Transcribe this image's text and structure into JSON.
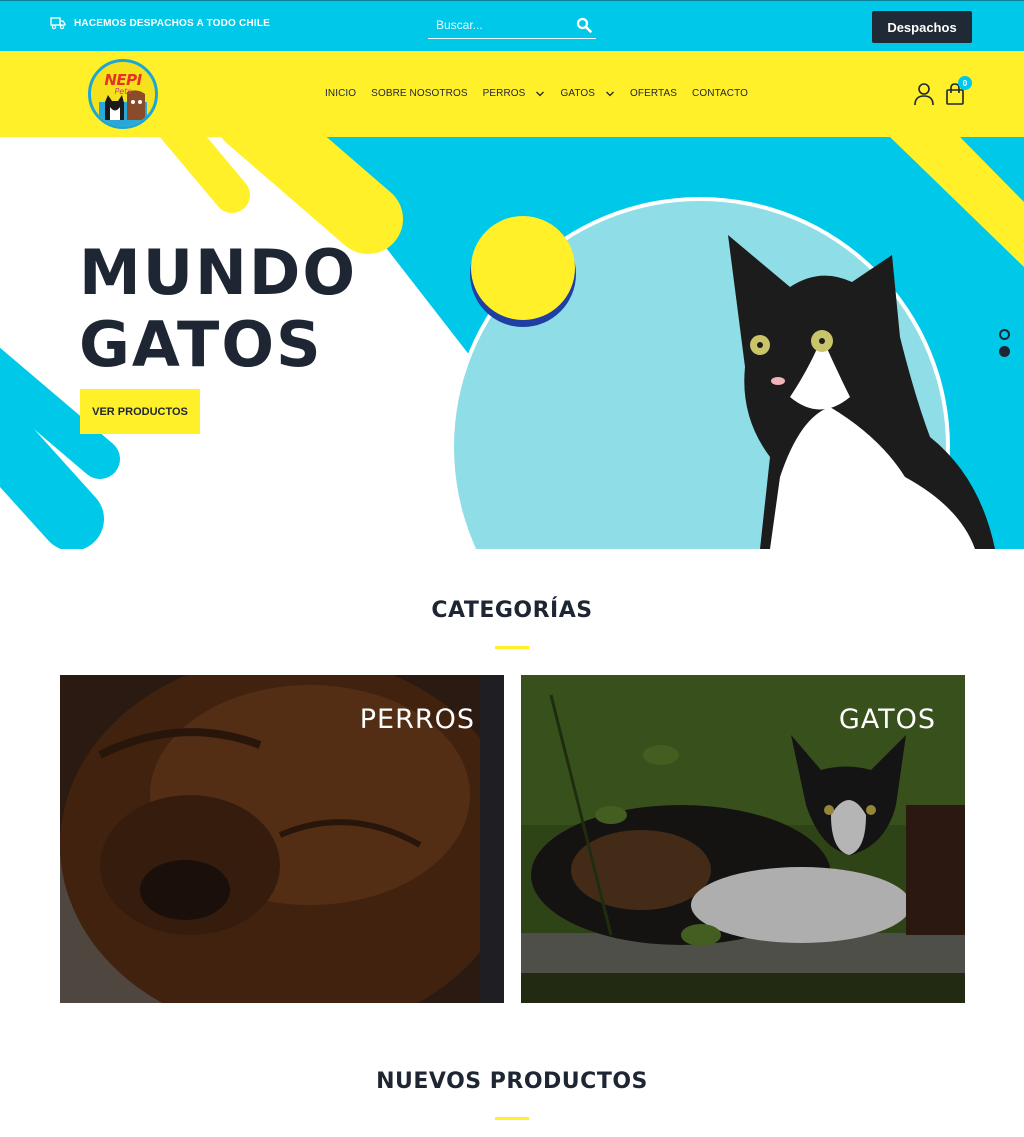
{
  "topbar": {
    "shipping_text": "HACEMOS DESPACHOS A TODO CHILE",
    "search_placeholder": "Buscar...",
    "despachos_label": "Despachos"
  },
  "header": {
    "logo_text": "NEPI",
    "nav": [
      {
        "label": "INICIO"
      },
      {
        "label": "SOBRE NOSOTROS"
      },
      {
        "label": "PERROS"
      },
      {
        "label": "GATOS"
      },
      {
        "label": "OFERTAS"
      },
      {
        "label": "CONTACTO"
      }
    ],
    "cart_count": "0"
  },
  "hero": {
    "title_line1": "MUNDO",
    "title_line2": "GATOS",
    "button_label": "VER PRODUCTOS"
  },
  "categories": {
    "title": "CATEGORÍAS",
    "items": [
      {
        "label": "PERROS"
      },
      {
        "label": "GATOS"
      }
    ]
  },
  "new_products": {
    "title": "NUEVOS PRODUCTOS"
  },
  "colors": {
    "accent_cyan": "#00c8e8",
    "accent_yellow": "#fff02a",
    "dark": "#1f2a36"
  }
}
